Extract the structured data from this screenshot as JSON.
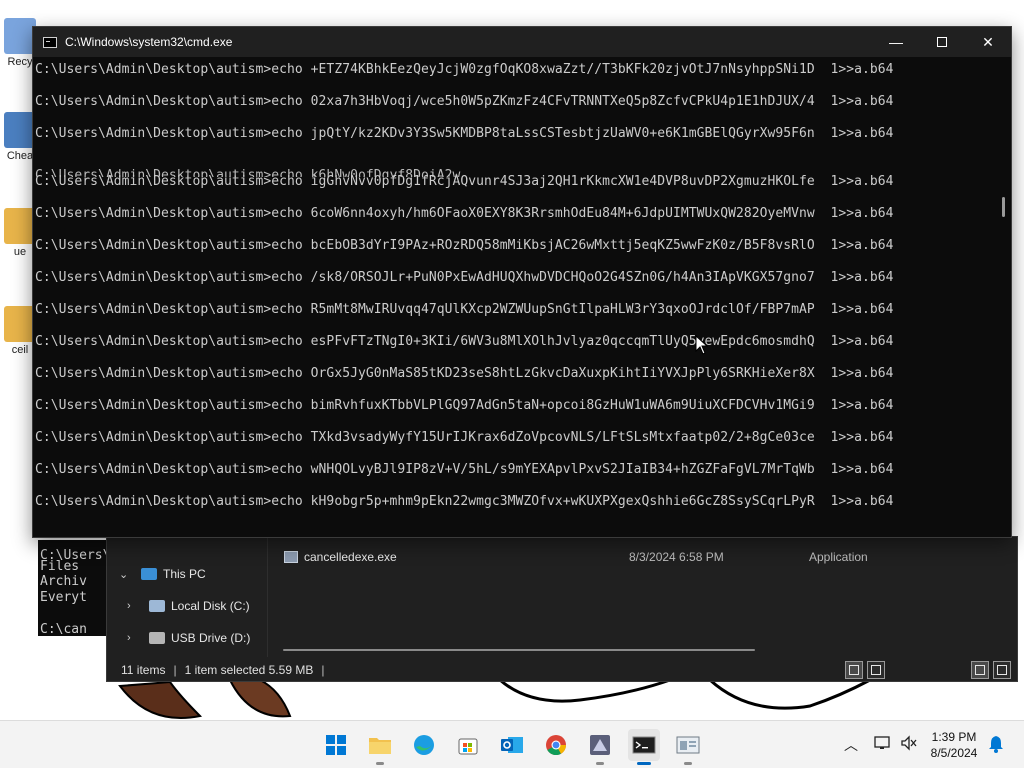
{
  "desktop": {
    "icons": [
      {
        "label": "Recy",
        "color": "#4f7cc9"
      },
      {
        "label": "Chea",
        "color": "#3a6fb0"
      },
      {
        "label": "ue",
        "color": "#e8b44a"
      },
      {
        "label": "ceil",
        "color": "#e8b44a"
      }
    ]
  },
  "cmd": {
    "title": "C:\\Windows\\system32\\cmd.exe",
    "prompt": "C:\\Users\\Admin\\Desktop\\autism>echo ",
    "redirect": "1>>a.b64",
    "partial_line": "C:\\Users\\Admin\\Desktop\\autism>echo k6hNw0ofDgyf8DoiA2w...",
    "lines": [
      "+ETZ74KBhkEezQeyJcjW0zgfOqKO8xwaZzt//T3bKFk20zjvOtJ7nNsyhppSNi1D",
      "02xa7h3HbVoqj/wce5h0W5pZKmzFz4CFvTRNNTXeQ5p8ZcfvCPkU4p1E1hDJUX/4",
      "jpQtY/kz2KDv3Y3Sw5KMDBP8taLssCSTesbtjzUaWV0+e6K1mGBElQGyrXw95F6n",
      "igGhvNvv0pfDg1fRcjAQvunr4SJ3aj2QH1rKkmcXW1e4DVP8uvDP2XgmuzHKOLfe",
      "6coW6nn4oxyh/hm6OFaoX0EXY8K3RrsmhOdEu84M+6JdpUIMTWUxQW282OyeMVnw",
      "bcEbOB3dYrI9PAz+ROzRDQ58mMiKbsjAC26wMxttj5eqKZ5wwFzK0z/B5F8vsRlO",
      "/sk8/ORSOJLr+PuN0PxEwAdHUQXhwDVDCHQoO2G4SZn0G/h4An3IApVKGX57gno7",
      "R5mMt8MwIRUvqq47qUlKXcp2WZWUupSnGtIlpaHLW3rY3qxoOJrdclOf/FBP7mAP",
      "esPFvFTzTNgI0+3KIi/6WV3u8MlXOlhJvlyaz0qccqmTlUyQ5yewEpdc6mosmdhQ",
      "OrGx5JyG0nMaS85tKD23seS8htLzGkvcDaXuxpKihtIiYVXJpPly6SRKHieXer8X",
      "bimRvhfuxKTbbVLPlGQ97AdGn5taN+opcoi8GzHuW1uWA6m9UiuXCFDCVHv1MGi9",
      "TXkd3vsadyWyfY15UrIJKrax6dZoVpcovNLS/LFtSLsMtxfaatp02/2+8gCe03ce",
      "wNHQOLvyBJl9IP8zV+V/5hL/s9mYEXApvlPxvS2JIaIB34+hZGZFaFgVL7MrTqWb",
      "kH9obgr5p+mhm9pEkn22wmgc3MWZOfvx+wKUXPXgexQshhie6GcZ8SsySCqrLPyR"
    ]
  },
  "bg_console": {
    "lines": [
      "C:\\Users\\",
      "Files",
      "Archiv",
      "Everyt",
      "C:\\can"
    ]
  },
  "explorer": {
    "nav": {
      "this_pc": "This PC",
      "local_disk": "Local Disk (C:)",
      "usb_drive": "USB Drive (D:)"
    },
    "file": {
      "name": "cancelledexe.exe",
      "date": "8/3/2024 6:58 PM",
      "type": "Application"
    },
    "status": {
      "items": "11 items",
      "selected": "1 item selected  5.59 MB"
    }
  },
  "taskbar": {
    "apps": [
      "start",
      "file-explorer",
      "edge",
      "store",
      "outlook",
      "chrome",
      "game",
      "terminal",
      "settings"
    ],
    "clock_time": "1:39 PM",
    "clock_date": "8/5/2024"
  }
}
